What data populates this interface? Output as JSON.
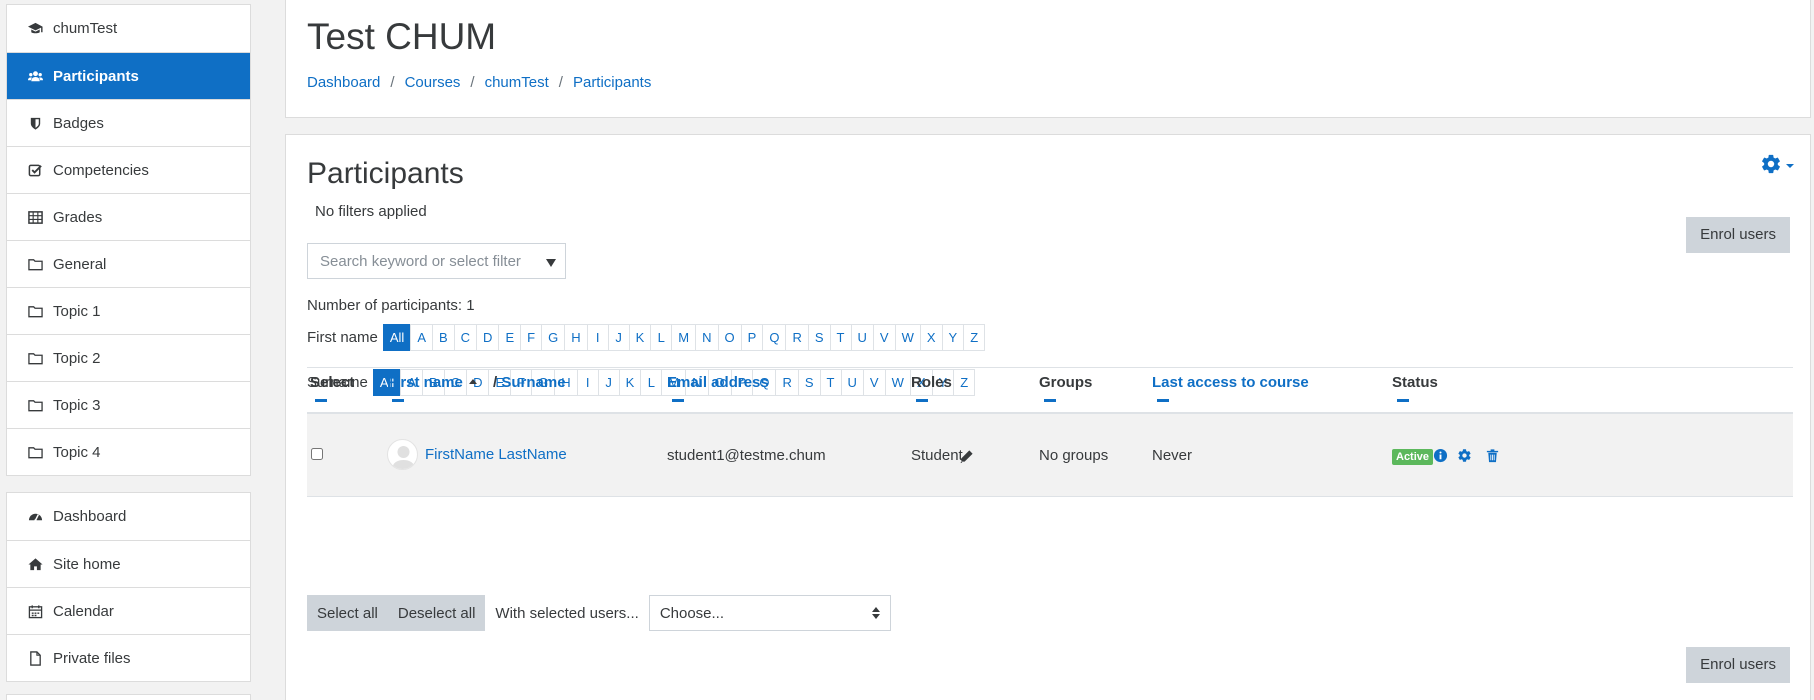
{
  "sidebar": {
    "course_items": [
      {
        "label": "chumTest",
        "icon": "graduation-cap-icon",
        "active": false
      },
      {
        "label": "Participants",
        "icon": "users-icon",
        "active": true
      },
      {
        "label": "Badges",
        "icon": "shield-icon",
        "active": false
      },
      {
        "label": "Competencies",
        "icon": "check-square-icon",
        "active": false
      },
      {
        "label": "Grades",
        "icon": "table-icon",
        "active": false
      },
      {
        "label": "General",
        "icon": "folder-icon",
        "active": false
      },
      {
        "label": "Topic 1",
        "icon": "folder-icon",
        "active": false
      },
      {
        "label": "Topic 2",
        "icon": "folder-icon",
        "active": false
      },
      {
        "label": "Topic 3",
        "icon": "folder-icon",
        "active": false
      },
      {
        "label": "Topic 4",
        "icon": "folder-icon",
        "active": false
      }
    ],
    "site_items": [
      {
        "label": "Dashboard",
        "icon": "tachometer-icon"
      },
      {
        "label": "Site home",
        "icon": "home-icon"
      },
      {
        "label": "Calendar",
        "icon": "calendar-icon"
      },
      {
        "label": "Private files",
        "icon": "file-icon"
      }
    ]
  },
  "header": {
    "title": "Test CHUM",
    "breadcrumb": [
      "Dashboard",
      "Courses",
      "chumTest",
      "Participants"
    ],
    "separator": "/"
  },
  "participants": {
    "title": "Participants",
    "no_filters": "No filters applied",
    "enrol_label": "Enrol users",
    "search_placeholder": "Search keyword or select filter",
    "count_text": "Number of participants: 1",
    "firstname_label": "First name",
    "surname_label": "Surname",
    "letters": [
      "All",
      "A",
      "B",
      "C",
      "D",
      "E",
      "F",
      "G",
      "H",
      "I",
      "J",
      "K",
      "L",
      "M",
      "N",
      "O",
      "P",
      "Q",
      "R",
      "S",
      "T",
      "U",
      "V",
      "W",
      "X",
      "Y",
      "Z"
    ]
  },
  "table": {
    "headers": {
      "select": "Select",
      "first_name": "First name",
      "surname_sep": "/",
      "surname": "Surname",
      "email": "Email address",
      "roles": "Roles",
      "groups": "Groups",
      "last_access": "Last access to course",
      "status": "Status"
    },
    "rows": [
      {
        "name": "FirstName LastName",
        "email": "student1@testme.chum",
        "role": "Student",
        "groups": "No groups",
        "last_access": "Never",
        "status": "Active"
      }
    ]
  },
  "bulk": {
    "select_all": "Select all",
    "deselect_all": "Deselect all",
    "with_selected": "With selected users...",
    "choose": "Choose..."
  },
  "colors": {
    "accent": "#0f6fc5",
    "active_badge": "#5cb85c",
    "button_grey": "#ced4da"
  }
}
